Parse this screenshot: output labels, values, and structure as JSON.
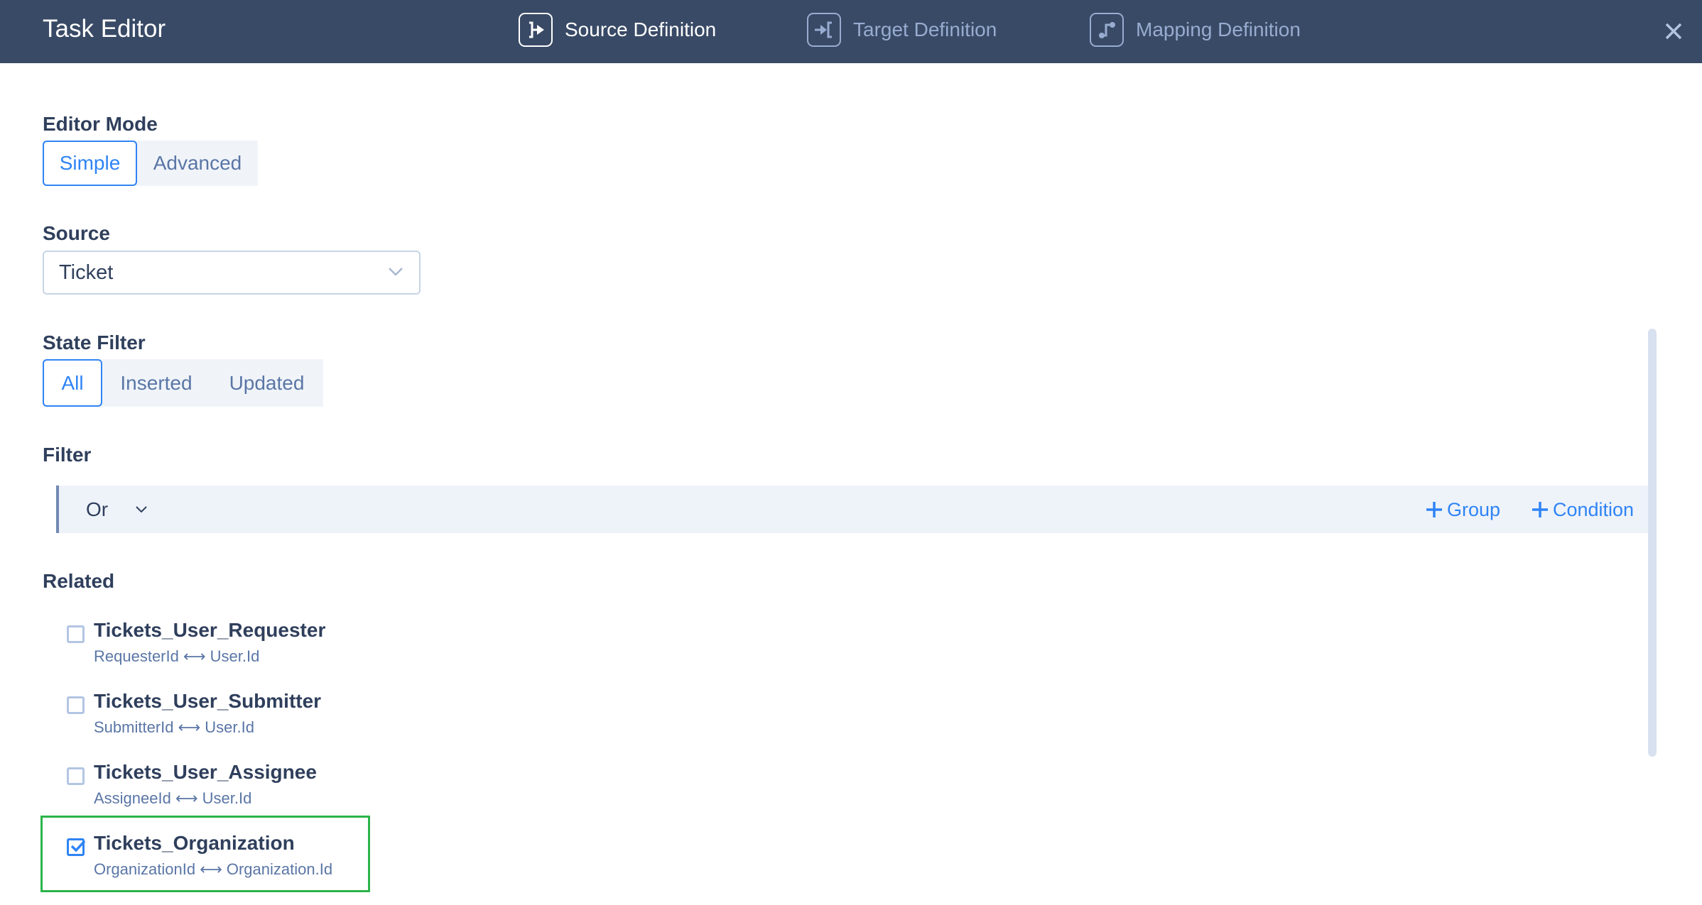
{
  "header": {
    "title": "Task Editor",
    "tabs": [
      {
        "label": "Source Definition",
        "icon": "source-definition-icon",
        "active": true
      },
      {
        "label": "Target Definition",
        "icon": "target-definition-icon",
        "active": false
      },
      {
        "label": "Mapping Definition",
        "icon": "mapping-definition-icon",
        "active": false
      }
    ],
    "close_icon": "close-icon"
  },
  "editor_mode": {
    "label": "Editor Mode",
    "options": [
      "Simple",
      "Advanced"
    ],
    "selected": "Simple"
  },
  "source": {
    "label": "Source",
    "value": "Ticket"
  },
  "state_filter": {
    "label": "State Filter",
    "options": [
      "All",
      "Inserted",
      "Updated"
    ],
    "selected": "All"
  },
  "filter": {
    "label": "Filter",
    "operator": "Or",
    "add_group_label": "Group",
    "add_condition_label": "Condition"
  },
  "related": {
    "label": "Related",
    "items": [
      {
        "name": "Tickets_User_Requester",
        "relation": "RequesterId ⟷ User.Id",
        "checked": false
      },
      {
        "name": "Tickets_User_Submitter",
        "relation": "SubmitterId ⟷ User.Id",
        "checked": false
      },
      {
        "name": "Tickets_User_Assignee",
        "relation": "AssigneeId ⟷ User.Id",
        "checked": false
      },
      {
        "name": "Tickets_Organization",
        "relation": "OrganizationId ⟷ Organization.Id",
        "checked": true
      }
    ],
    "highlighted_item": "Tickets_Organization"
  },
  "colors": {
    "header_bg": "#394a66",
    "accent": "#2f84f5",
    "highlight_border": "#2db34a",
    "muted_text": "#5a76a6"
  }
}
